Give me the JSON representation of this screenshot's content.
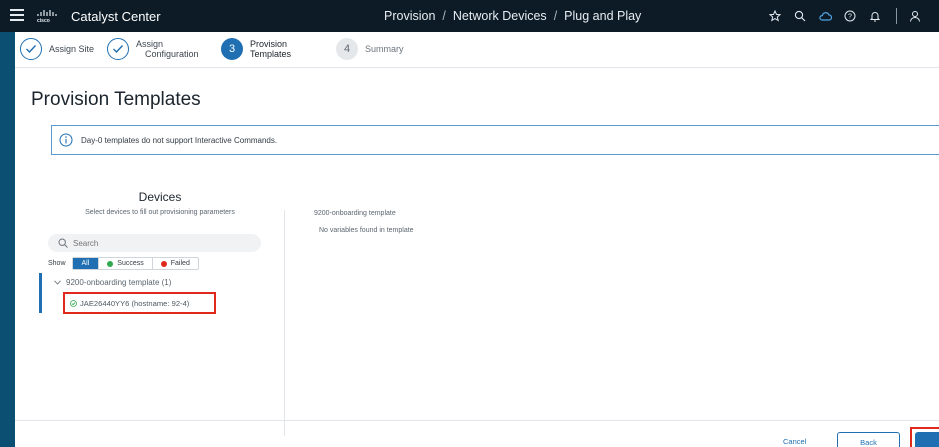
{
  "header": {
    "app_title": "Catalyst Center",
    "breadcrumb": [
      "Provision",
      "Network Devices",
      "Plug and Play"
    ],
    "separator": "/",
    "icons": [
      "star-icon",
      "search-icon",
      "cloud-icon",
      "help-icon",
      "bell-icon",
      "user-icon"
    ]
  },
  "wizard": {
    "steps": [
      {
        "label_line1": "Assign Site",
        "label_line2": "",
        "state": "done"
      },
      {
        "label_line1": "Assign",
        "label_line2": "Configuration",
        "state": "done"
      },
      {
        "number": "3",
        "label_line1": "Provision",
        "label_line2": "Templates",
        "state": "active"
      },
      {
        "number": "4",
        "label_line1": "Summary",
        "label_line2": "",
        "state": "todo"
      }
    ]
  },
  "page": {
    "title": "Provision Templates"
  },
  "alert": {
    "message": "Day-0 templates do not support Interactive Commands."
  },
  "devices": {
    "heading": "Devices",
    "subheading": "Select devices to fill out provisioning parameters",
    "search_placeholder": "Search",
    "show_label": "Show",
    "filters": {
      "all": "All",
      "success": "Success",
      "failed": "Failed"
    },
    "group_label": "9200-onboarding template (1)",
    "device_label": "JAE26440YY6 (hostname: 92-4)"
  },
  "template": {
    "name": "9200-onboarding template",
    "message": "No variables found in template"
  },
  "footer": {
    "cancel": "Cancel",
    "back": "Back",
    "next": ""
  },
  "colors": {
    "accent": "#1f6fb2",
    "header_bg": "#0d1b26",
    "frame_bg": "#0b4f73",
    "success": "#2fa84f",
    "failed": "#e0281d",
    "highlight": "#e0281d"
  }
}
